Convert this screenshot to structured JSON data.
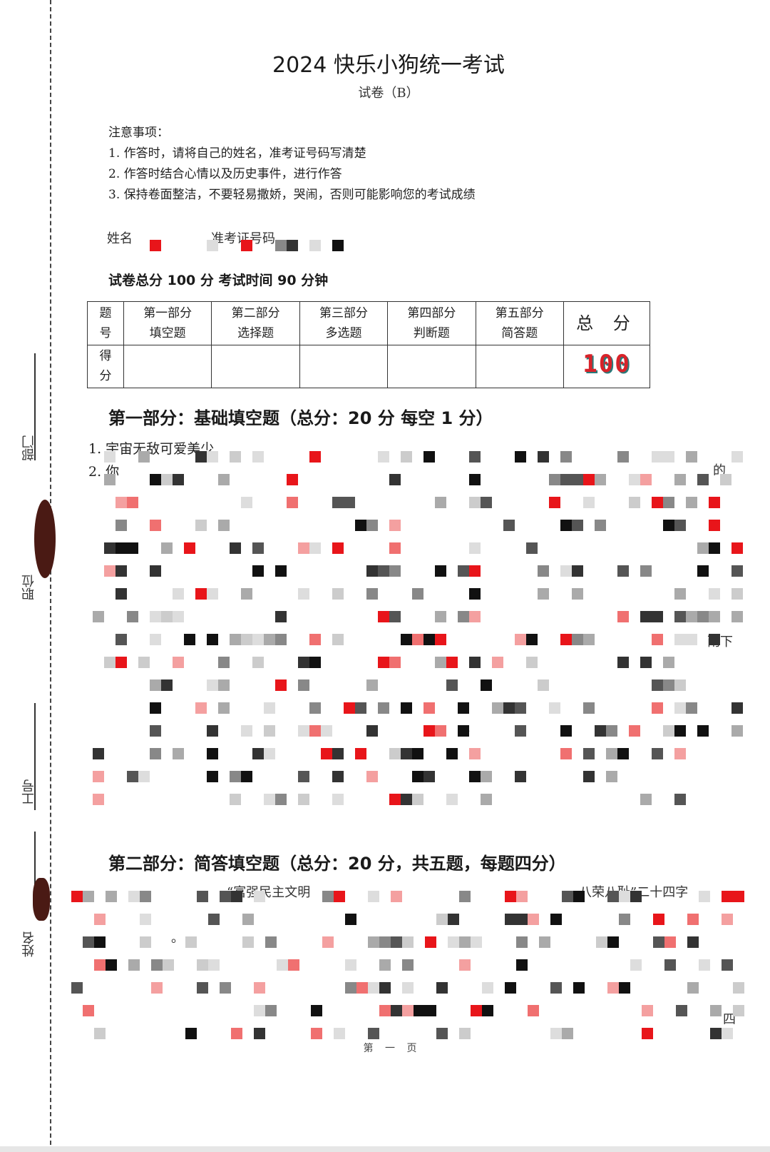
{
  "header": {
    "title": "2024 快乐小狗统一考试",
    "subtitle": "试卷（B）"
  },
  "notice": {
    "heading": "注意事项：",
    "items": [
      "1.  作答时，请将自己的姓名，准考证号码写清楚",
      "2.  作答时结合心情以及历史事件，进行作答",
      "3.  保持卷面整洁，不要轻易撒娇，哭闹，否则可能影响您的考试成绩"
    ]
  },
  "fields": {
    "name_label": "姓名",
    "id_label": "准考证号码"
  },
  "score_info": "试卷总分 100 分  考试时间 90 分钟",
  "score_table": {
    "row1_label": [
      "题",
      "号"
    ],
    "row2_label": [
      "得",
      "分"
    ],
    "parts": [
      {
        "line1": "第一部分",
        "line2": "填空题"
      },
      {
        "line1": "第二部分",
        "line2": "选择题"
      },
      {
        "line1": "第三部分",
        "line2": "多选题"
      },
      {
        "line1": "第四部分",
        "line2": "判断题"
      },
      {
        "line1": "第五部分",
        "line2": "简答题"
      }
    ],
    "total_label": "总 分",
    "total_score": "100"
  },
  "section1": {
    "heading": "第一部分：基础填空题（总分：20 分    每空 1 分）",
    "q1": "1.  宇宙无敌可爱美少",
    "q2": "2.  你",
    "fragments": [
      "的",
      "雨下",
      "。"
    ]
  },
  "section2": {
    "heading": "第二部分：简答填空题（总分：20 分，共五题，每题四分）",
    "fragment1": "“富强民主文明",
    "fragment2": "八荣八耻”二十四字",
    "fragment3": "。",
    "fragment4": "四"
  },
  "side_labels": {
    "dept": "部门",
    "position": "职位",
    "employee_id": "工号",
    "name": "姓名"
  },
  "footer": "第 一 页",
  "colors": {
    "stamp_red": "#d8232a",
    "stamp_shadow": "#2a7a7a",
    "mosaic_red": "#e8151a"
  }
}
